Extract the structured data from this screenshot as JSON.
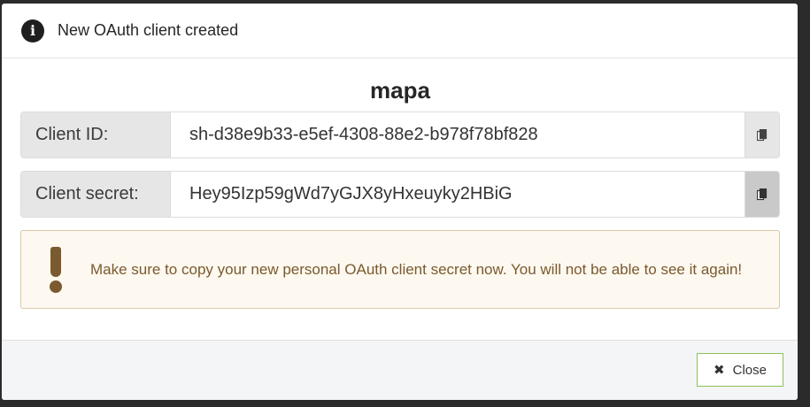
{
  "dialog": {
    "title": "New OAuth client created",
    "info_icon_glyph": "i",
    "app_name": "mapa"
  },
  "fields": {
    "client_id": {
      "label": "Client ID:",
      "value": "sh-d38e9b33-e5ef-4308-88e2-b978f78bf828"
    },
    "client_secret": {
      "label": "Client secret:",
      "value": "Hey95Izp59gWd7yGJX8yHxeuyky2HBiG"
    }
  },
  "warning": {
    "text": "Make sure to copy your new personal OAuth client secret now. You will not be able to see it again!"
  },
  "footer": {
    "close_label": "Close",
    "close_icon": "✖"
  },
  "icons": {
    "info": "info-circle-icon",
    "copy": "copy-icon",
    "warning": "exclamation-icon",
    "close": "times-icon"
  },
  "colors": {
    "warning_text": "#7a5a2e",
    "warning_bg": "#fdf8f0",
    "close_border": "#8ac25a"
  }
}
